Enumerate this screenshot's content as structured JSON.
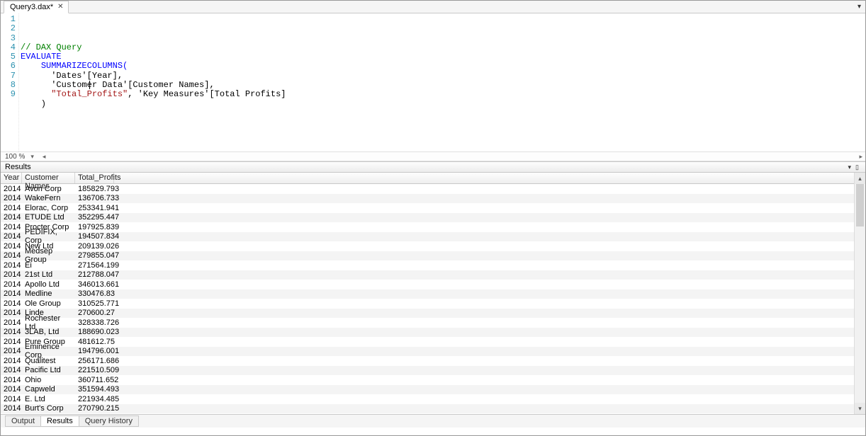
{
  "tab": {
    "label": "Query3.dax*"
  },
  "zoom": {
    "level": "100 %"
  },
  "code": {
    "lines": [
      {
        "n": "1",
        "segments": [
          {
            "cls": "c-comment",
            "text": "// DAX Query"
          }
        ]
      },
      {
        "n": "2",
        "segments": [
          {
            "cls": "c-kw",
            "text": "EVALUATE"
          }
        ]
      },
      {
        "n": "3",
        "segments": [
          {
            "cls": "c-plain",
            "text": "    "
          },
          {
            "cls": "c-kw",
            "text": "SUMMARIZECOLUMNS("
          }
        ]
      },
      {
        "n": "4",
        "segments": [
          {
            "cls": "c-plain",
            "text": "      'Dates'[Year],"
          }
        ]
      },
      {
        "n": "5",
        "segments": [
          {
            "cls": "c-plain",
            "text": "      'Customer Data'[Customer Names],"
          }
        ]
      },
      {
        "n": "6",
        "segments": [
          {
            "cls": "c-plain",
            "text": "      "
          },
          {
            "cls": "c-str",
            "text": "\"Total_Profits\""
          },
          {
            "cls": "c-plain",
            "text": ", 'Key Measures'[Total Profits]"
          }
        ]
      },
      {
        "n": "7",
        "segments": [
          {
            "cls": "c-plain",
            "text": "    )"
          }
        ]
      },
      {
        "n": "8",
        "segments": [
          {
            "cls": "c-plain",
            "text": ""
          }
        ]
      },
      {
        "n": "9",
        "segments": [
          {
            "cls": "c-plain",
            "text": ""
          }
        ]
      }
    ]
  },
  "results": {
    "title": "Results",
    "columns": [
      "Year",
      "Customer Names",
      "Total_Profits"
    ],
    "rows": [
      {
        "year": "2014",
        "name": "Avon Corp",
        "val": "185829.793"
      },
      {
        "year": "2014",
        "name": "WakeFern",
        "val": "136706.733"
      },
      {
        "year": "2014",
        "name": "Elorac, Corp",
        "val": "253341.941"
      },
      {
        "year": "2014",
        "name": "ETUDE Ltd",
        "val": "352295.447"
      },
      {
        "year": "2014",
        "name": "Procter Corp",
        "val": "197925.839"
      },
      {
        "year": "2014",
        "name": "PEDIFIX, Corp",
        "val": "194507.834"
      },
      {
        "year": "2014",
        "name": "New Ltd",
        "val": "209139.026"
      },
      {
        "year": "2014",
        "name": "Medsep Group",
        "val": "279855.047"
      },
      {
        "year": "2014",
        "name": "Ei",
        "val": "271564.199"
      },
      {
        "year": "2014",
        "name": "21st Ltd",
        "val": "212788.047"
      },
      {
        "year": "2014",
        "name": "Apollo Ltd",
        "val": "346013.661"
      },
      {
        "year": "2014",
        "name": "Medline",
        "val": "330476.83"
      },
      {
        "year": "2014",
        "name": "Ole Group",
        "val": "310525.771"
      },
      {
        "year": "2014",
        "name": "Linde",
        "val": "270600.27"
      },
      {
        "year": "2014",
        "name": "Rochester Ltd",
        "val": "328338.726"
      },
      {
        "year": "2014",
        "name": "3LAB, Ltd",
        "val": "188690.023"
      },
      {
        "year": "2014",
        "name": "Pure Group",
        "val": "481612.75"
      },
      {
        "year": "2014",
        "name": "Eminence Corp",
        "val": "194796.001"
      },
      {
        "year": "2014",
        "name": "Qualitest",
        "val": "256171.686"
      },
      {
        "year": "2014",
        "name": "Pacific Ltd",
        "val": "221510.509"
      },
      {
        "year": "2014",
        "name": "Ohio",
        "val": "360711.652"
      },
      {
        "year": "2014",
        "name": "Capweld",
        "val": "351594.493"
      },
      {
        "year": "2014",
        "name": "E. Ltd",
        "val": "221934.485"
      },
      {
        "year": "2014",
        "name": "Burt's Corp",
        "val": "270790.215"
      }
    ]
  },
  "bottom_tabs": {
    "output": "Output",
    "results": "Results",
    "history": "Query History"
  }
}
